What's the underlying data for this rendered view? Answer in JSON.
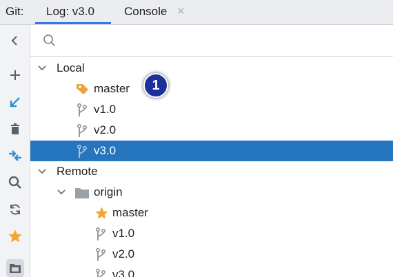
{
  "tabbar": {
    "prefix": "Git:",
    "tabs": [
      {
        "label": "Log: v3.0",
        "active": true
      },
      {
        "label": "Console",
        "active": false
      }
    ],
    "close_glyph": "×"
  },
  "toolbar": {
    "icons": [
      "chevron-left-icon",
      "plus-icon",
      "checkout-arrow-icon",
      "trash-icon",
      "compare-arrows-icon",
      "search-icon",
      "refresh-icon",
      "star-icon",
      "folder-icon"
    ]
  },
  "search": {
    "placeholder": "",
    "value": ""
  },
  "tree": {
    "local": {
      "label": "Local",
      "branches": [
        {
          "label": "master",
          "icon": "tag-icon",
          "current": true
        },
        {
          "label": "v1.0",
          "icon": "branch-icon"
        },
        {
          "label": "v2.0",
          "icon": "branch-icon"
        },
        {
          "label": "v3.0",
          "icon": "branch-icon",
          "selected": true
        }
      ]
    },
    "remote": {
      "label": "Remote",
      "origin": {
        "label": "origin",
        "branches": [
          {
            "label": "master",
            "icon": "star-icon"
          },
          {
            "label": "v1.0",
            "icon": "branch-icon"
          },
          {
            "label": "v2.0",
            "icon": "branch-icon"
          },
          {
            "label": "v3.0",
            "icon": "branch-icon"
          }
        ]
      }
    }
  },
  "callout": {
    "number": "1"
  },
  "colors": {
    "accent": "#3574f0",
    "selection": "#2675bf",
    "tag": "#e8a33d",
    "star": "#f2a631",
    "badge": "#1c2f9a"
  }
}
